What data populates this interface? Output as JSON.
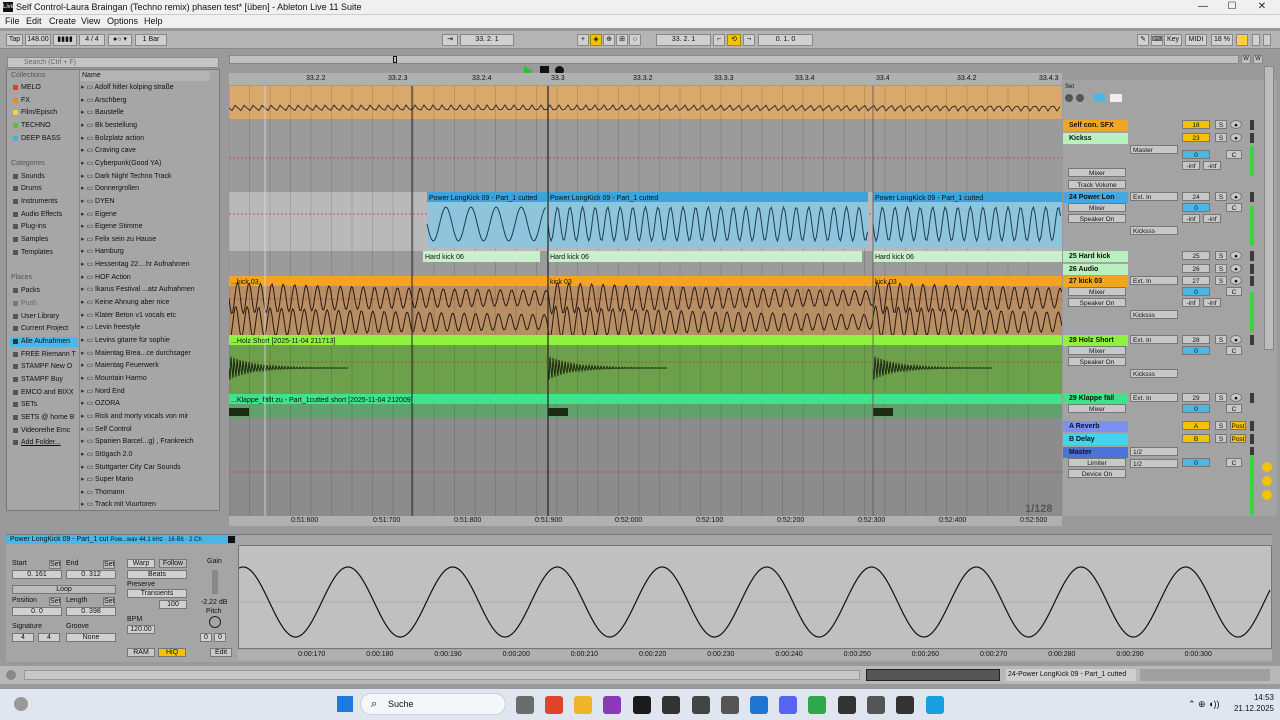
{
  "window": {
    "title": "Self Control-Laura Braingan (Techno remix) phasen test* [üben] - Ableton Live 11 Suite",
    "logo": "Live"
  },
  "menu": [
    "File",
    "Edit",
    "Create",
    "View",
    "Options",
    "Help"
  ],
  "transport": {
    "tap": "Tap",
    "tempo": "148.00",
    "signature": "4 / 4",
    "quantize": "1 Bar",
    "position": "33. 2. 1",
    "loop_start": "33. 2. 1",
    "loop_length": "0. 1. 0",
    "key": "Key",
    "midi": "MIDI",
    "cpu": "18 %"
  },
  "browser": {
    "search_placeholder": "Search (Ctrl + F)",
    "collections_label": "Collections",
    "collections": [
      {
        "label": "MELO",
        "color": "#e33b2e"
      },
      {
        "label": "FX",
        "color": "#f08a1c"
      },
      {
        "label": "Film/Episch",
        "color": "#f0d43a"
      },
      {
        "label": "TECHNO",
        "color": "#4fc24a"
      },
      {
        "label": "DEEP BASS",
        "color": "#3db7e0"
      }
    ],
    "categories_label": "Categories",
    "categories": [
      "Sounds",
      "Drums",
      "Instruments",
      "Audio Effects",
      "Plug-ins",
      "Samples",
      "Templates"
    ],
    "places_label": "Places",
    "places": [
      "Packs",
      "Push",
      "User Library",
      "Current Project",
      "Alle Aufnahmen",
      "FREE Riemann T",
      "STAMPF New O",
      "STAMPF Buy",
      "EMCO and BIXX",
      "SETs",
      "SETS @ home B",
      "Videoreihe Emc",
      "Add Folder..."
    ],
    "name_header": "Name",
    "folders": [
      "Adolf hitler kolping straße",
      "Arschberg",
      "Baustelle",
      "Bk bestellung",
      "Bolzplatz action",
      "Craving cave",
      "Cyberpunk(Good YA)",
      "Dark Night Techno Track",
      "Donnergrollen",
      "DYEN",
      "Eigene",
      "Eigene Stimme",
      "Felix sein zu Hause",
      "Hamburg",
      "Hessentag 22....hr Aufnahmen",
      "HOF Action",
      "Ikarus Festival ...atz Aufnahmen",
      "Keine Ahnung aber nice",
      "Klater Beton v1 vocals etc",
      "Levin freestyle",
      "Levins gitarre für sophie",
      "Maientag Brea...ce durchsager",
      "Maientag Feuerwerk",
      "Mountain Harmo",
      "Nord End",
      "OZORA",
      "Rick and morty vocals von mir",
      "Self Control",
      "Spanien Barcel...g) , Frankreich",
      "Stögach 2.0",
      "Stuttgarter City Car Sounds",
      "Super Mario",
      "Thomann",
      "Track mit Vuurtoren"
    ]
  },
  "ruler": {
    "bars": [
      "33.2.2",
      "33.2.3",
      "33.2.4",
      "33.3",
      "33.3.2",
      "33.3.3",
      "33.3.4",
      "33.4",
      "33.4.2",
      "33.4.3"
    ],
    "times": [
      "0:51:600",
      "0:51:700",
      "0:51:800",
      "0:51:900",
      "0:52:000",
      "0:52:100",
      "0:52:200",
      "0:52:300",
      "0:52:400",
      "0:52:500"
    ],
    "zoom": "1/128"
  },
  "clips": {
    "powerkick": [
      "Power LongKick 09 - Part_1 cutted",
      "Power LongKick 09 - Part_1 cutted",
      "Power LongKick 09 - Part_1 cutted"
    ],
    "hardkick": [
      "Hard kick 06",
      "Hard kick 06",
      "Hard kick 06"
    ],
    "kick03": [
      "...kick 03",
      "kick 03",
      "kick 03"
    ],
    "holz": "...Holz Short [2025-11-04 211713]",
    "klappe": "...Klappe_fällt zu - Part_1cutted short [2025-11-04 212009]"
  },
  "tracks": [
    {
      "name": "Self con. SFX",
      "color": "#f3a522",
      "num": "18"
    },
    {
      "name": "Kickss",
      "color": "#b9f0c0",
      "num": "23",
      "out": "Master",
      "dev1": "Mixer",
      "dev2": "Track Volume",
      "vol": "0",
      "left": "-inf",
      "right": "-inf"
    },
    {
      "name": "24 Power Lon",
      "color": "#42a8df",
      "num": "24",
      "in": "Ext. In",
      "dev1": "Mixer",
      "dev2": "Speaker On",
      "vol": "0",
      "left": "-inf",
      "right": "-inf",
      "grp": "Kicksss"
    },
    {
      "name": "25 Hard kick",
      "color": "#b9f0c0",
      "num": "25"
    },
    {
      "name": "26 Audio",
      "color": "#b9f0c0",
      "num": "26"
    },
    {
      "name": "27 kick 03",
      "color": "#f3a522",
      "num": "27",
      "in": "Ext. In",
      "dev1": "Mixer",
      "dev2": "Speaker On",
      "vol": "0",
      "left": "-inf",
      "right": "-inf",
      "grp": "Kicksss"
    },
    {
      "name": "28 Holz Short",
      "color": "#8ef33f",
      "num": "28",
      "in": "Ext. In",
      "dev1": "Mixer",
      "dev2": "Speaker On",
      "vol": "0",
      "grp": "Kicksss"
    },
    {
      "name": "29 Klappe fäll",
      "color": "#3fe389",
      "num": "29",
      "in": "Ext. In",
      "dev1": "Mixer",
      "vol": "0"
    },
    {
      "name": "A Reverb",
      "color": "#7d8ff0",
      "send": "A",
      "post": "Post"
    },
    {
      "name": "B Delay",
      "color": "#42d4f0",
      "send": "B",
      "post": "Post"
    },
    {
      "name": "Master",
      "color": "#4a72d9",
      "dev1": "Limiter",
      "dev2": "Device On",
      "out": "1/2",
      "in": "1/2",
      "vol": "0"
    }
  ],
  "detail": {
    "clip_name": "Power LongKick 09 - Part_1 cut",
    "clip_info": "Pow...wav  44.1 kHz · 16-Bit · 2 Ch",
    "start": "Start",
    "end": "End",
    "set": "Set",
    "start_val": "0. 161",
    "end_val": "0. 312",
    "loop": "Loop",
    "position": "Position",
    "length": "Length",
    "pos_val": "0. 0",
    "len_val": "0. 398",
    "signature": "Signature",
    "groove": "Groove",
    "sig_a": "4",
    "sig_b": "4",
    "groove_val": "None",
    "warp": "Warp",
    "follow": "Follow",
    "warp_mode": "Beats",
    "preserve": "Preserve",
    "transients": "Transients",
    "beats_val": "100",
    "bpm_label": "BPM",
    "bpm": "120.00",
    "gain": "Gain",
    "gain_val": "-2.22 dB",
    "pitch": "Pitch",
    "pitch_a": "0",
    "pitch_b": "0",
    "ram": "RAM",
    "hiq": "HiQ",
    "edit": "Edit",
    "times": [
      "0:00:170",
      "0:00:180",
      "0:00:190",
      "0:00:200",
      "0:00:210",
      "0:00:220",
      "0:00:230",
      "0:00:240",
      "0:00:250",
      "0:00:260",
      "0:00:270",
      "0:00:280",
      "0:00:290",
      "0:00:300"
    ]
  },
  "status": {
    "track_label": "24-Power LongKick 09 - Part_1 cutted"
  },
  "taskbar": {
    "search": "Suche",
    "time": "14:53",
    "date": "21.12.2025"
  },
  "colors": {
    "accent": "#f3c200",
    "selection": "#4ab7e6"
  }
}
